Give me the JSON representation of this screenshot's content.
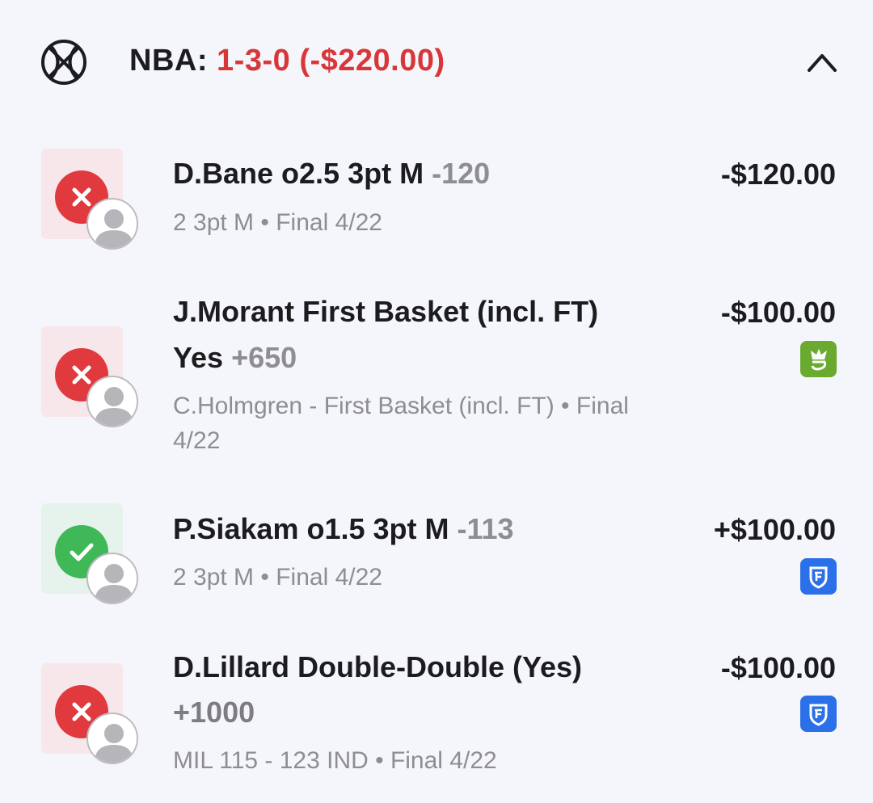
{
  "header": {
    "league": "NBA:",
    "record": "1-3-0 (-$220.00)",
    "sport_icon": "basketball-icon",
    "toggle_icon": "chevron-up-icon"
  },
  "colors": {
    "loss": "#e0393e",
    "win": "#3fb957",
    "record_red": "#d8373a",
    "draftkings_green": "#6aaa2f",
    "fanduel_blue": "#2b70e8"
  },
  "bets": [
    {
      "status": "loss",
      "title": "D.Bane o2.5 3pt M",
      "odds": "-120",
      "title_line2": "",
      "subtitle": "2 3pt M • Final 4/22",
      "subtitle_line2": "",
      "amount": "-$120.00",
      "book": ""
    },
    {
      "status": "loss",
      "title": "J.Morant First Basket (incl. FT)",
      "title_line2": "Yes",
      "odds": "+650",
      "subtitle": "C.Holmgren - First Basket (incl. FT) • Final",
      "subtitle_line2": "4/22",
      "amount": "-$100.00",
      "book": "draftkings-icon"
    },
    {
      "status": "win",
      "title": "P.Siakam o1.5 3pt M",
      "odds": "-113",
      "title_line2": "",
      "subtitle": "2 3pt M • Final 4/22",
      "subtitle_line2": "",
      "amount": "+$100.00",
      "book": "fanduel-icon"
    },
    {
      "status": "loss",
      "title": "D.Lillard Double-Double (Yes)",
      "title_line2": "",
      "odds": "+1000",
      "subtitle": "MIL 115 - 123 IND • Final 4/22",
      "subtitle_line2": "",
      "amount": "-$100.00",
      "book": "fanduel-icon"
    }
  ]
}
